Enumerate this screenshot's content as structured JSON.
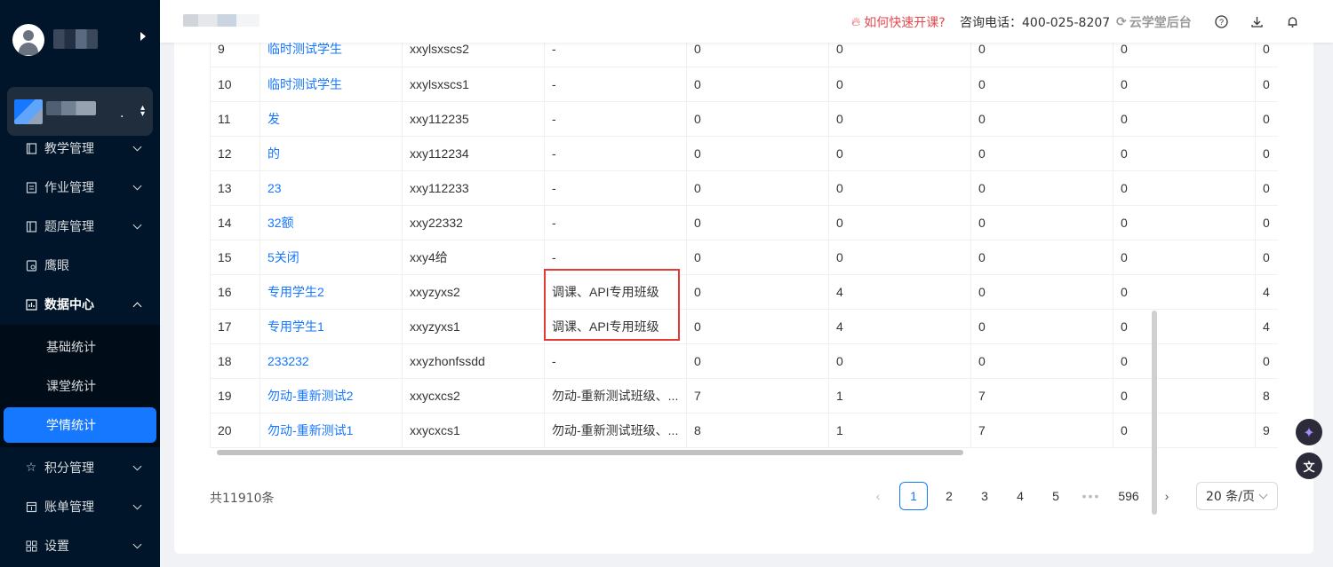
{
  "sidebar": {
    "menu": [
      {
        "label": "教学管理",
        "icon": "book-icon"
      },
      {
        "label": "作业管理",
        "icon": "file-icon"
      },
      {
        "label": "题库管理",
        "icon": "library-icon"
      },
      {
        "label": "鹰眼",
        "icon": "eye-icon"
      },
      {
        "label": "数据中心",
        "icon": "chart-icon"
      },
      {
        "label": "积分管理",
        "icon": "star-icon"
      },
      {
        "label": "账单管理",
        "icon": "bill-icon"
      },
      {
        "label": "设置",
        "icon": "grid-icon"
      }
    ],
    "submenu": [
      {
        "label": "基础统计"
      },
      {
        "label": "课堂统计"
      },
      {
        "label": "学情统计"
      }
    ],
    "colors": {
      "bg": "#001529",
      "active": "#1677ff"
    }
  },
  "header": {
    "quick_link": "如何快速开课?",
    "consult": "咨询电话：400-025-8207",
    "backend": "云学堂后台"
  },
  "table": {
    "rows": [
      [
        "9",
        "临时测试学生",
        "xxylsxscs2",
        "-",
        "0",
        "0",
        "0",
        "0",
        "0"
      ],
      [
        "10",
        "临时测试学生",
        "xxylsxscs1",
        "-",
        "0",
        "0",
        "0",
        "0",
        "0"
      ],
      [
        "11",
        "发",
        "xxy112235",
        "-",
        "0",
        "0",
        "0",
        "0",
        "0"
      ],
      [
        "12",
        "的",
        "xxy112234",
        "-",
        "0",
        "0",
        "0",
        "0",
        "0"
      ],
      [
        "13",
        "23",
        "xxy112233",
        "-",
        "0",
        "0",
        "0",
        "0",
        "0"
      ],
      [
        "14",
        "32额",
        "xxy22332",
        "-",
        "0",
        "0",
        "0",
        "0",
        "0"
      ],
      [
        "15",
        "5关闭",
        "xxy4给",
        "-",
        "0",
        "0",
        "0",
        "0",
        "0"
      ],
      [
        "16",
        "专用学生2",
        "xxyzyxs2",
        "调课、API专用班级",
        "0",
        "4",
        "0",
        "0",
        "4"
      ],
      [
        "17",
        "专用学生1",
        "xxyzyxs1",
        "调课、API专用班级",
        "0",
        "4",
        "0",
        "0",
        "4"
      ],
      [
        "18",
        "233232",
        "xxyzhonfssdd",
        "-",
        "0",
        "0",
        "0",
        "0",
        "0"
      ],
      [
        "19",
        "勿动-重新测试2",
        "xxycxcs2",
        "勿动-重新测试班级、...",
        "7",
        "1",
        "7",
        "0",
        "8"
      ],
      [
        "20",
        "勿动-重新测试1",
        "xxycxcs1",
        "勿动-重新测试班级、...",
        "8",
        "1",
        "7",
        "0",
        "9"
      ]
    ]
  },
  "pagination": {
    "total": "共11910条",
    "pages": [
      "1",
      "2",
      "3",
      "4",
      "5"
    ],
    "ellipsis": "•••",
    "last": "596",
    "page_size": "20 条/页",
    "current": "1"
  }
}
